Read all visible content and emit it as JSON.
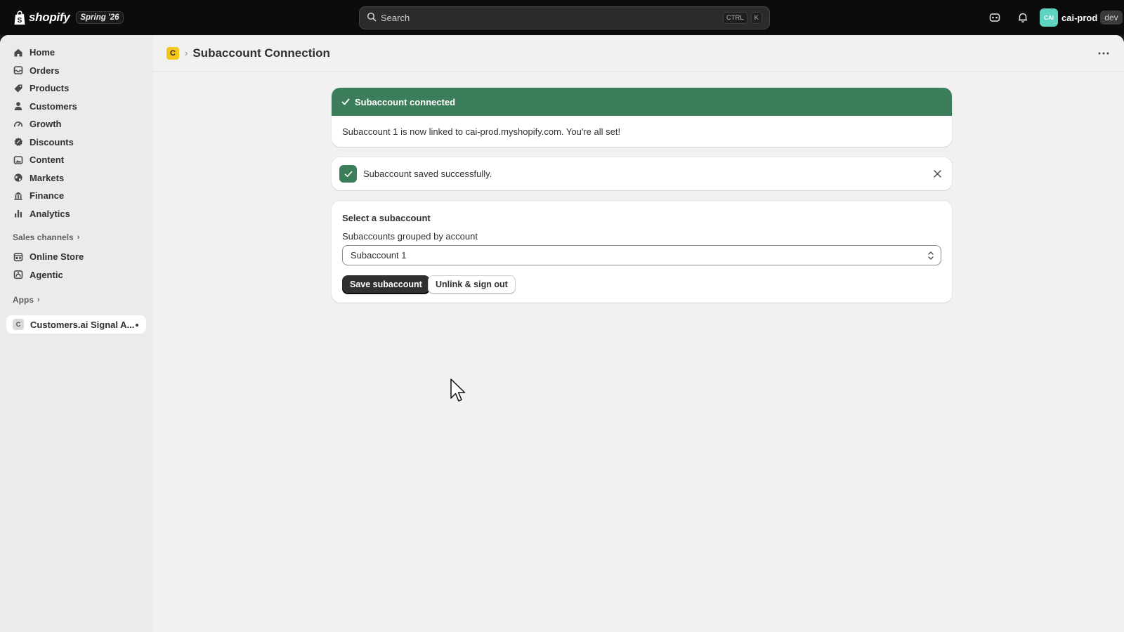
{
  "topbar": {
    "brand": "shopify",
    "edition": "Spring '26",
    "search_placeholder": "Search",
    "shortcut_ctrl": "CTRL",
    "shortcut_key": "K",
    "store_avatar": "CAI",
    "store_name": "cai-prod",
    "store_badge": "dev"
  },
  "sidebar": {
    "items": [
      {
        "label": "Home",
        "icon": "home-icon"
      },
      {
        "label": "Orders",
        "icon": "orders-icon"
      },
      {
        "label": "Products",
        "icon": "tag-icon"
      },
      {
        "label": "Customers",
        "icon": "person-icon"
      },
      {
        "label": "Growth",
        "icon": "gauge-icon"
      },
      {
        "label": "Discounts",
        "icon": "discount-icon"
      },
      {
        "label": "Content",
        "icon": "image-icon"
      },
      {
        "label": "Markets",
        "icon": "globe-icon"
      },
      {
        "label": "Finance",
        "icon": "bank-icon"
      },
      {
        "label": "Analytics",
        "icon": "bar-chart-icon"
      }
    ],
    "sales_channels_label": "Sales channels",
    "channels": [
      {
        "label": "Online Store",
        "icon": "store-icon"
      },
      {
        "label": "Agentic",
        "icon": "agent-icon"
      }
    ],
    "apps_label": "Apps",
    "app": {
      "label": "Customers.ai Signal A...",
      "icon_letter": "C"
    }
  },
  "page": {
    "title": "Subaccount Connection",
    "breadcrumb_icon": "C"
  },
  "banner": {
    "title": "Subaccount connected",
    "message": "Subaccount 1 is now linked to cai-prod.myshopify.com. You're all set!"
  },
  "toast": {
    "message": "Subaccount saved successfully."
  },
  "form": {
    "title": "Select a subaccount",
    "label": "Subaccounts grouped by account",
    "selected": "Subaccount 1",
    "save_label": "Save subaccount",
    "unlink_label": "Unlink & sign out"
  },
  "colors": {
    "success": "#3c7d5c",
    "topbar": "#0c0c0c",
    "primary_button": "#303030"
  }
}
